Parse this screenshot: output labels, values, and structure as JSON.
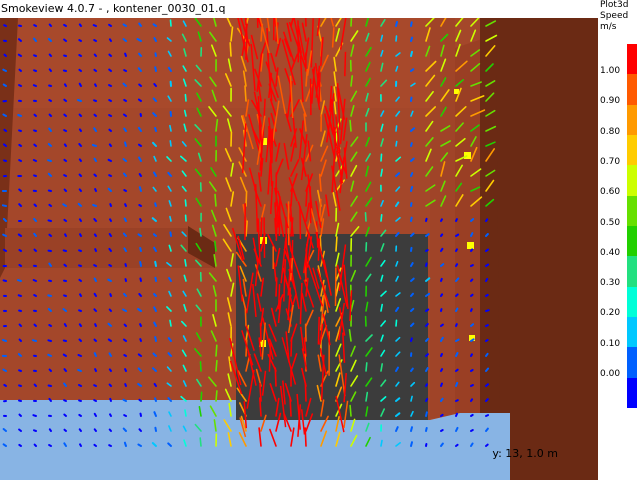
{
  "window": {
    "title": "Smokeview 4.0.7 - , kontener_0030_01.q"
  },
  "viewport": {
    "slice_label": "y: 13, 1.0 m"
  },
  "legend": {
    "title_line1": "Plot3d",
    "title_line2": "Speed",
    "units": "m/s",
    "ticks": [
      "1.00",
      "0.90",
      "0.80",
      "0.70",
      "0.60",
      "0.50",
      "0.40",
      "0.30",
      "0.20",
      "0.10",
      "0.00"
    ],
    "colors": [
      "#ff0000",
      "#ff5a00",
      "#ff9a00",
      "#ffcc00",
      "#ccff00",
      "#66e000",
      "#22d000",
      "#22e080",
      "#00ffd8",
      "#00c8ff",
      "#0060ff",
      "#0000ff"
    ]
  },
  "colors": {
    "wall": "#a4472a",
    "floor": "#88b4e4",
    "container_dark": "#3c3c3c",
    "structure": "#6b2a14"
  }
}
